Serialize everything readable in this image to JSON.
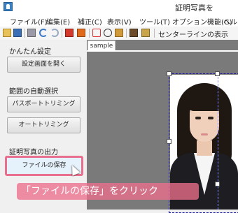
{
  "window": {
    "title": "証明写真を"
  },
  "menu": [
    "ファイル(F)",
    "編集(E)",
    "補正(C)",
    "表示(V)",
    "ツール(T)",
    "オプション機能(G)",
    "ヘル"
  ],
  "toolbar": {
    "centerline_label": "センターラインの表示"
  },
  "sidebar": {
    "section_easy": "かんたん設定",
    "btn_open_settings": "設定画面を開く",
    "section_auto_select": "範囲の自動選択",
    "btn_passport_trim": "パスポートトリミング",
    "btn_auto_trim": "オートトリミング",
    "section_output": "証明写真の出力",
    "btn_save_file": "ファイルの保存"
  },
  "workspace": {
    "tab_label": "sample"
  },
  "caption": "「ファイルの保存」をクリック",
  "colors": {
    "highlight": "#e8708e",
    "caption_bg": "#ec6e8c",
    "selection": "#1a1aa0"
  }
}
